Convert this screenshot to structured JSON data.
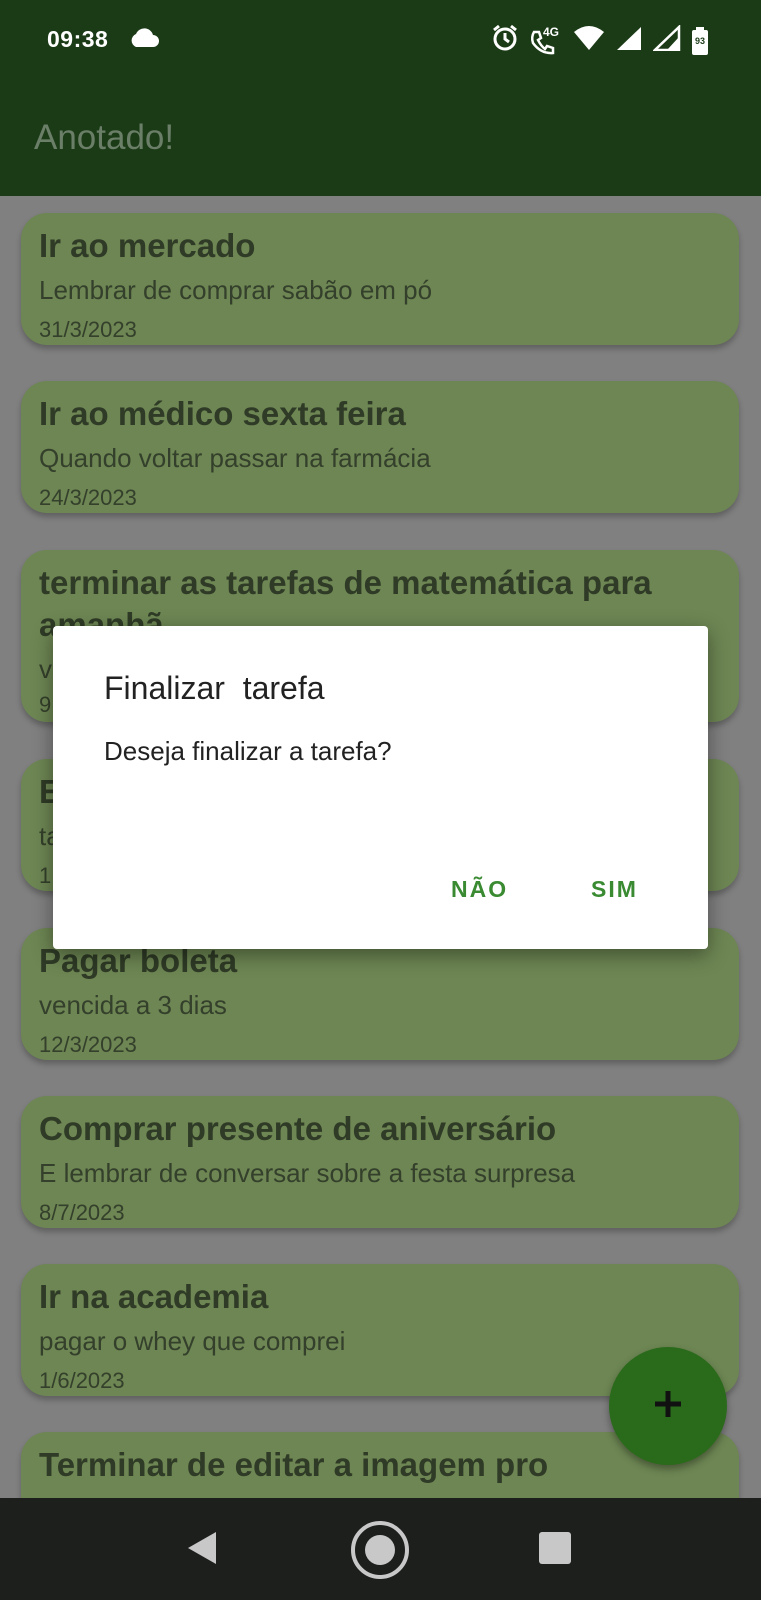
{
  "status_bar": {
    "time": "09:38",
    "network": "4G",
    "battery": "93"
  },
  "app_bar": {
    "title": "Anotado!"
  },
  "tasks": [
    {
      "title": "Ir ao mercado",
      "description": "Lembrar de comprar sabão em pó",
      "date": "31/3/2023"
    },
    {
      "title": "Ir ao médico sexta feira",
      "description": "Quando voltar passar na farmácia",
      "date": "24/3/2023"
    },
    {
      "title": "terminar as tarefas de matemática para amanhã",
      "description": "v",
      "date": "9"
    },
    {
      "title": "E",
      "description": "ta",
      "date": "1"
    },
    {
      "title": "Pagar boleta",
      "description": "vencida a 3 dias",
      "date": "12/3/2023"
    },
    {
      "title": "Comprar presente de aniversário",
      "description": "E lembrar de conversar sobre a festa surpresa",
      "date": "8/7/2023"
    },
    {
      "title": "Ir na academia",
      "description": "pagar o whey que comprei",
      "date": "1/6/2023"
    },
    {
      "title": "Terminar de editar a imagem pro",
      "description": "",
      "date": ""
    }
  ],
  "fab": {
    "icon": "plus-icon"
  },
  "dialog": {
    "title": "Finalizar  tarefa",
    "message": "Deseja finalizar a tarefa?",
    "negative_label": "NÃO",
    "positive_label": "SIM"
  },
  "nav_bar": {
    "icons": [
      "back-icon",
      "home-icon",
      "recents-icon"
    ]
  },
  "colors": {
    "app_bar": "#1b3b17",
    "card": "#6d8653",
    "accent": "#3a8a32",
    "fab": "#2a6a1b"
  }
}
